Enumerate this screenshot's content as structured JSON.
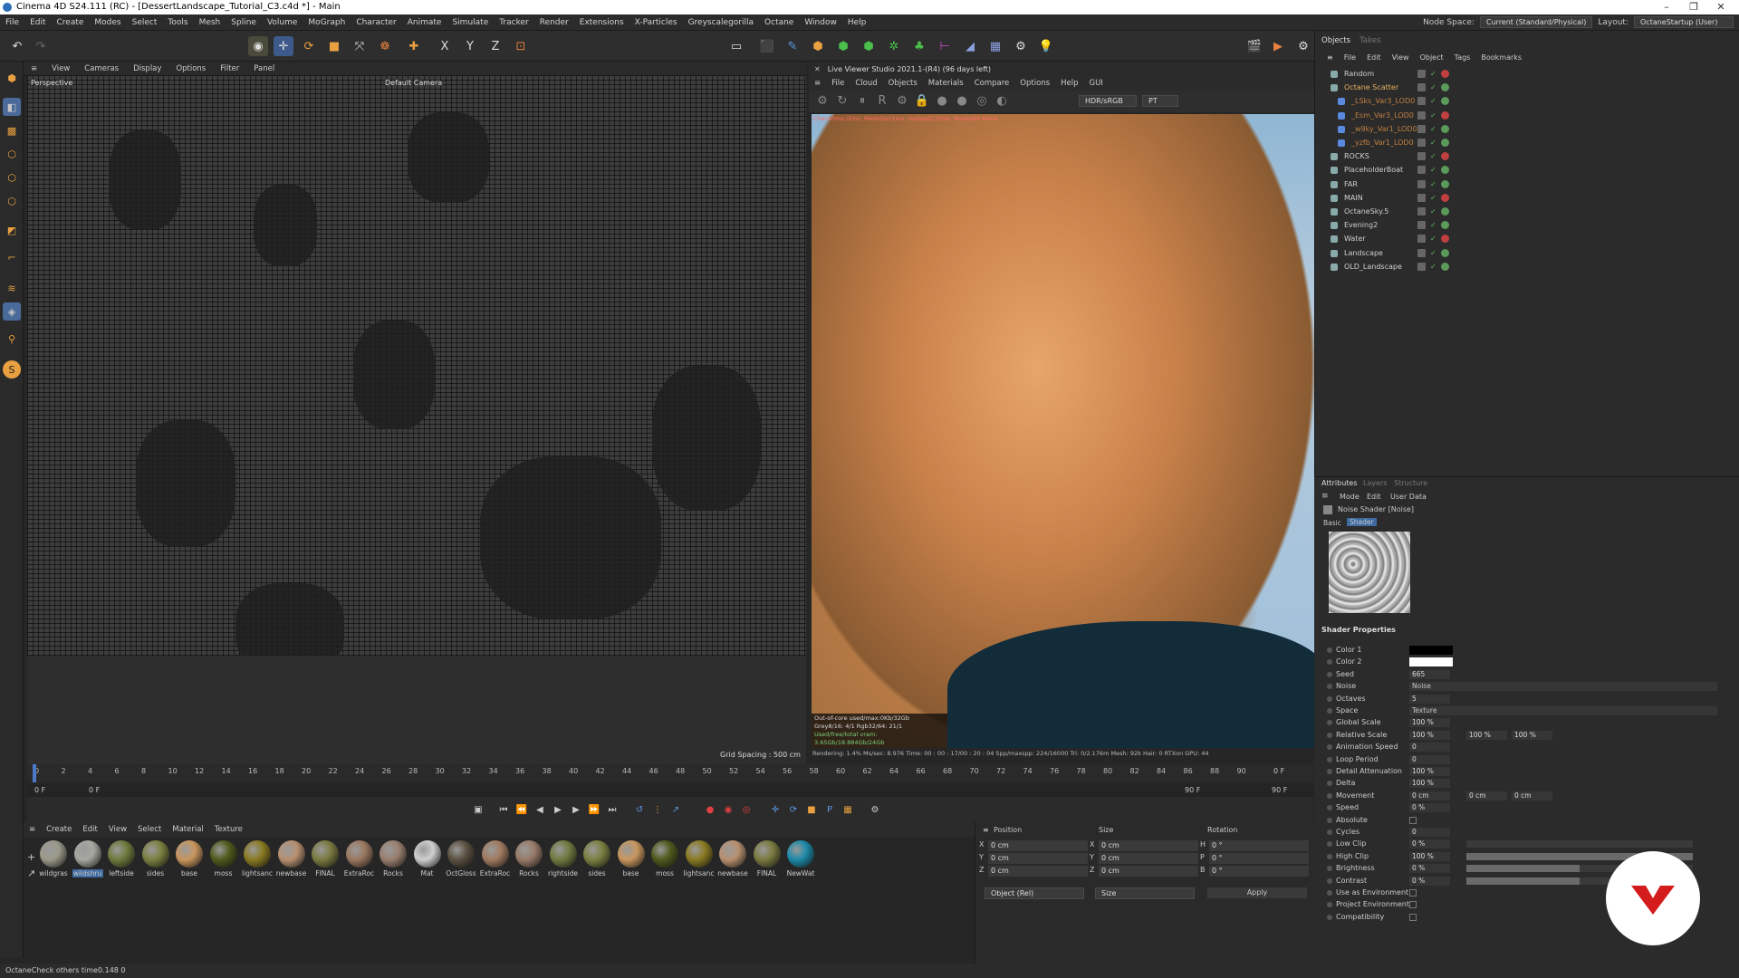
{
  "window": {
    "title": "Cinema 4D S24.111 (RC) - [DessertLandscape_Tutorial_C3.c4d *] - Main"
  },
  "menubar": {
    "items": [
      "File",
      "Edit",
      "Create",
      "Modes",
      "Select",
      "Tools",
      "Mesh",
      "Spline",
      "Volume",
      "MoGraph",
      "Character",
      "Animate",
      "Simulate",
      "Tracker",
      "Render",
      "Extensions",
      "X-Particles",
      "Greyscalegorilla",
      "Octane",
      "Window",
      "Help"
    ],
    "node_space_label": "Node Space:",
    "node_space_value": "Current (Standard/Physical)",
    "layout_label": "Layout:",
    "layout_value": "OctaneStartup (User)"
  },
  "viewport": {
    "menu": [
      "View",
      "Cameras",
      "Display",
      "Options",
      "Filter",
      "Panel"
    ],
    "mode_label": "Perspective",
    "camera_label": "Default Camera",
    "grid_spacing": "Grid Spacing : 500 cm"
  },
  "live_viewer": {
    "title": "Live Viewer Studio 2021.1-(R4) (96 days left)",
    "menu": [
      "File",
      "Cloud",
      "Objects",
      "Materials",
      "Compare",
      "Options",
      "Help",
      "GUI"
    ],
    "color_space": "HDR/sRGB",
    "render_mode": "PT",
    "check_text": "Check0ms./2ms. MeshGen1ms. Update[C]0ms. Nodes84 Mova",
    "stats": [
      "Out-of-core used/max:0Kb/32Gb",
      "Grey8/16: 4/1       Rgb32/64: 21/1",
      "Used/free/total vram: 3.65Gb/18.884Gb/24Gb"
    ],
    "status": "Rendering: 1.4%  Ms/sec: 8.976  Time: 00 : 00 : 17/00 : 20 : 04  Spp/maxspp: 224/16000  Tri: 0/2.176m  Mesh: 92k  Hair: 0  RTXon  GPU: 44"
  },
  "timeline": {
    "ticks": [
      "0",
      "2",
      "4",
      "6",
      "8",
      "10",
      "12",
      "14",
      "16",
      "18",
      "20",
      "22",
      "24",
      "26",
      "28",
      "30",
      "32",
      "34",
      "36",
      "38",
      "40",
      "42",
      "44",
      "46",
      "48",
      "50",
      "52",
      "54",
      "56",
      "58",
      "60",
      "62",
      "64",
      "66",
      "68",
      "70",
      "72",
      "74",
      "76",
      "78",
      "80",
      "82",
      "84",
      "86",
      "88",
      "90"
    ],
    "end_frame": "0 F",
    "start_field": "0 F",
    "current_field": "0 F",
    "end_field_a": "90 F",
    "end_field_b": "90 F"
  },
  "materials": {
    "menu": [
      "Create",
      "Edit",
      "View",
      "Select",
      "Material",
      "Texture"
    ],
    "items": [
      {
        "name": "wildgras",
        "color": "#9a9a8a"
      },
      {
        "name": "wildshru",
        "color": "#a8a8a0"
      },
      {
        "name": "leftside",
        "color": "#6d7a3c"
      },
      {
        "name": "sides",
        "color": "#7a8040"
      },
      {
        "name": "base",
        "color": "#c9965e"
      },
      {
        "name": "moss",
        "color": "#4f5a1c"
      },
      {
        "name": "lightsanc",
        "color": "#8a7a22"
      },
      {
        "name": "newbase",
        "color": "#b89070"
      },
      {
        "name": "FINAL",
        "color": "#7a7a40"
      },
      {
        "name": "ExtraRoc",
        "color": "#9a7860"
      },
      {
        "name": "Rocks",
        "color": "#9a8070"
      },
      {
        "name": "Mat",
        "color": "#cfcfcf"
      },
      {
        "name": "OctGloss",
        "color": "#5a5040"
      },
      {
        "name": "ExtraRoc",
        "color": "#a07a60"
      },
      {
        "name": "Rocks",
        "color": "#987a68"
      },
      {
        "name": "rightside",
        "color": "#707a40"
      },
      {
        "name": "sides",
        "color": "#7a8040"
      },
      {
        "name": "base",
        "color": "#c9965e"
      },
      {
        "name": "moss",
        "color": "#4f5a1c"
      },
      {
        "name": "lightsanc",
        "color": "#8a7a22"
      },
      {
        "name": "newbase",
        "color": "#b89070"
      },
      {
        "name": "FINAL",
        "color": "#7a7a40"
      },
      {
        "name": "NewWat",
        "color": "#1c8aa8"
      }
    ]
  },
  "coords": {
    "headers": [
      "Position",
      "Size",
      "Rotation"
    ],
    "rows": [
      {
        "axis": "X",
        "pos": "0 cm",
        "saxis": "X",
        "size": "0 cm",
        "raxis": "H",
        "rot": "0 °"
      },
      {
        "axis": "Y",
        "pos": "0 cm",
        "saxis": "Y",
        "size": "0 cm",
        "raxis": "P",
        "rot": "0 °"
      },
      {
        "axis": "Z",
        "pos": "0 cm",
        "saxis": "Z",
        "size": "0 cm",
        "raxis": "B",
        "rot": "0 °"
      }
    ],
    "mode": "Object (Rel)",
    "size_mode": "Size",
    "apply": "Apply"
  },
  "objects_panel": {
    "tabs": [
      "Objects",
      "Takes"
    ],
    "menu": [
      "File",
      "Edit",
      "View",
      "Object",
      "Tags",
      "Bookmarks"
    ],
    "items": [
      {
        "name": "Random",
        "color": "#cfcfcf"
      },
      {
        "name": "Octane Scatter",
        "color": "#e8b060"
      },
      {
        "name": "_LSks_Var3_LOD0",
        "color": "#c08040"
      },
      {
        "name": "_Esm_Var3_LOD0",
        "color": "#c08040"
      },
      {
        "name": "_w9ky_Var1_LOD0",
        "color": "#c08040"
      },
      {
        "name": "_yzfb_Var1_LOD0",
        "color": "#c08040"
      },
      {
        "name": "ROCKS",
        "color": "#cfcfcf"
      },
      {
        "name": "PlaceholderBoat",
        "color": "#cfcfcf"
      },
      {
        "name": "FAR",
        "color": "#cfcfcf"
      },
      {
        "name": "MAIN",
        "color": "#cfcfcf"
      },
      {
        "name": "OctaneSky.5",
        "color": "#cfcfcf"
      },
      {
        "name": "Evening2",
        "color": "#cfcfcf"
      },
      {
        "name": "Water",
        "color": "#cfcfcf"
      },
      {
        "name": "Landscape",
        "color": "#cfcfcf"
      },
      {
        "name": "OLD_Landscape",
        "color": "#cfcfcf"
      }
    ]
  },
  "attributes": {
    "tabs": [
      "Attributes",
      "Layers",
      "Structure"
    ],
    "menu": [
      "Mode",
      "Edit",
      "User Data"
    ],
    "object_title": "Noise Shader [Noise]",
    "subtabs": [
      "Basic",
      "Shader"
    ],
    "section": "Shader Properties",
    "rows": [
      {
        "label": "Color 1",
        "value": ""
      },
      {
        "label": "Color 2",
        "value": ""
      },
      {
        "label": "Seed",
        "value": "665"
      },
      {
        "label": "Noise",
        "value": "Noise"
      },
      {
        "label": "Octaves",
        "value": "5"
      },
      {
        "label": "Space",
        "value": "Texture"
      },
      {
        "label": "Global Scale",
        "value": "100 %"
      },
      {
        "label": "Relative Scale",
        "value": "100 %"
      },
      {
        "label": "Animation Speed",
        "value": "0"
      },
      {
        "label": "Loop Period",
        "value": "0"
      },
      {
        "label": "Detail Attenuation",
        "value": "100 %"
      },
      {
        "label": "Delta",
        "value": "100 %"
      },
      {
        "label": "Movement",
        "value": "0 cm"
      },
      {
        "label": "Speed",
        "value": "0 %"
      },
      {
        "label": "Absolute",
        "value": ""
      },
      {
        "label": "Cycles",
        "value": "0"
      },
      {
        "label": "Low Clip",
        "value": "0 %",
        "fill": 0.0
      },
      {
        "label": "High Clip",
        "value": "100 %",
        "fill": 1.0
      },
      {
        "label": "Brightness",
        "value": "0 %",
        "fill": 0.5
      },
      {
        "label": "Contrast",
        "value": "0 %",
        "fill": 0.5
      },
      {
        "label": "Use as Environment",
        "value": ""
      },
      {
        "label": "Project Environment",
        "value": ""
      },
      {
        "label": "Compatibility",
        "value": ""
      }
    ],
    "relative_scale_y": "100 %",
    "relative_scale_z": "100 %",
    "movement_y": "0 cm",
    "movement_z": "0 cm"
  },
  "statusbar": {
    "text": "OctaneCheck others time0.148  0"
  }
}
